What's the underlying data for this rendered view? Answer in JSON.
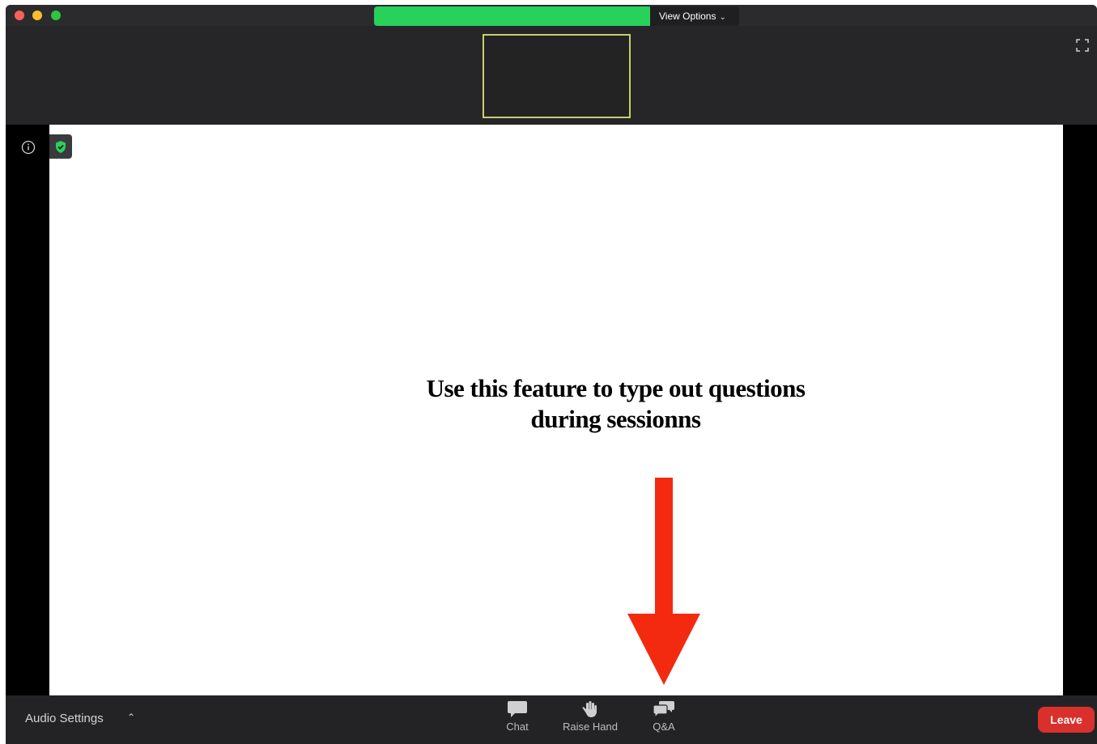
{
  "titlebar": {
    "view_options_label": "View Options",
    "share_bar_color": "#27d15a"
  },
  "slide": {
    "line1": "Use this feature to type out questions",
    "line2": "during sessionns",
    "arrow_color": "#f42a10",
    "icons": [
      "info-icon",
      "shield-check-icon"
    ]
  },
  "toolbar": {
    "audio_settings_label": "Audio Settings",
    "items": [
      {
        "label": "Chat",
        "icon": "chat-icon"
      },
      {
        "label": "Raise Hand",
        "icon": "hand-icon"
      },
      {
        "label": "Q&A",
        "icon": "qa-icon"
      }
    ],
    "leave_label": "Leave",
    "leave_color": "#d9302c"
  }
}
